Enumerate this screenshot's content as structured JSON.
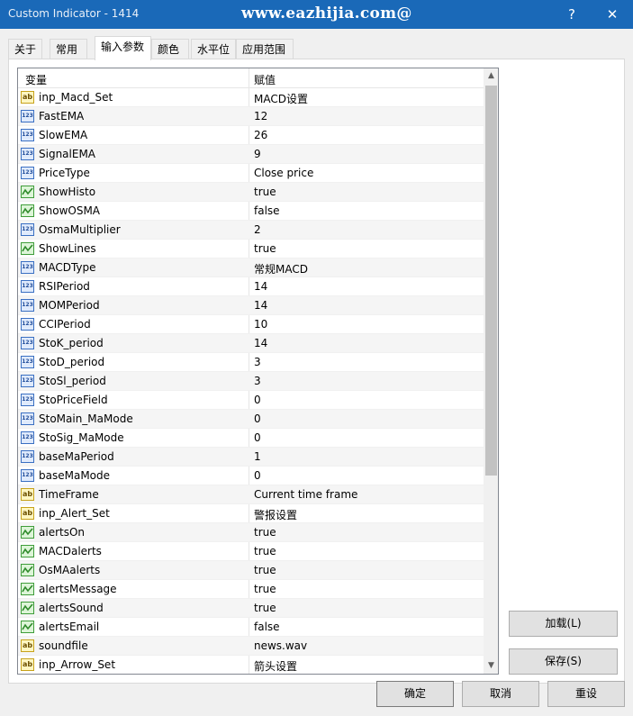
{
  "window": {
    "title": "Custom Indicator - 1414",
    "brand": "www.eazhijia.com@",
    "help_glyph": "?",
    "close_glyph": "✕"
  },
  "tabs": [
    {
      "label": "关于"
    },
    {
      "label": "常用"
    },
    {
      "label": "输入参数",
      "active": true
    },
    {
      "label": "颜色"
    },
    {
      "label": "水平位"
    },
    {
      "label": "应用范围"
    }
  ],
  "grid": {
    "col_variable": "变量",
    "col_value": "赋值",
    "rows": [
      {
        "icon": "ab",
        "name": "inp_Macd_Set",
        "value": "MACD设置"
      },
      {
        "icon": "123",
        "name": "FastEMA",
        "value": "12"
      },
      {
        "icon": "123",
        "name": "SlowEMA",
        "value": "26"
      },
      {
        "icon": "123",
        "name": "SignalEMA",
        "value": "9"
      },
      {
        "icon": "123",
        "name": "PriceType",
        "value": "Close price"
      },
      {
        "icon": "bool",
        "name": "ShowHisto",
        "value": "true"
      },
      {
        "icon": "bool",
        "name": "ShowOSMA",
        "value": "false"
      },
      {
        "icon": "123",
        "name": "OsmaMultiplier",
        "value": "2"
      },
      {
        "icon": "bool",
        "name": "ShowLines",
        "value": "true"
      },
      {
        "icon": "123",
        "name": "MACDType",
        "value": "常规MACD"
      },
      {
        "icon": "123",
        "name": "RSIPeriod",
        "value": "14"
      },
      {
        "icon": "123",
        "name": "MOMPeriod",
        "value": "14"
      },
      {
        "icon": "123",
        "name": "CCIPeriod",
        "value": "10"
      },
      {
        "icon": "123",
        "name": "StoK_period",
        "value": "14"
      },
      {
        "icon": "123",
        "name": "StoD_period",
        "value": "3"
      },
      {
        "icon": "123",
        "name": "StoSl_period",
        "value": "3"
      },
      {
        "icon": "123",
        "name": "StoPriceField",
        "value": "0"
      },
      {
        "icon": "123",
        "name": "StoMain_MaMode",
        "value": "0"
      },
      {
        "icon": "123",
        "name": "StoSig_MaMode",
        "value": "0"
      },
      {
        "icon": "123",
        "name": "baseMaPeriod",
        "value": "1"
      },
      {
        "icon": "123",
        "name": "baseMaMode",
        "value": "0"
      },
      {
        "icon": "ab",
        "name": "TimeFrame",
        "value": "Current time frame"
      },
      {
        "icon": "ab",
        "name": "inp_Alert_Set",
        "value": "警报设置"
      },
      {
        "icon": "bool",
        "name": "alertsOn",
        "value": "true"
      },
      {
        "icon": "bool",
        "name": "MACDalerts",
        "value": "true"
      },
      {
        "icon": "bool",
        "name": "OsMAalerts",
        "value": "true"
      },
      {
        "icon": "bool",
        "name": "alertsMessage",
        "value": "true"
      },
      {
        "icon": "bool",
        "name": "alertsSound",
        "value": "true"
      },
      {
        "icon": "bool",
        "name": "alertsEmail",
        "value": "false"
      },
      {
        "icon": "ab",
        "name": "soundfile",
        "value": "news.wav"
      },
      {
        "icon": "ab",
        "name": "inp_Arrow_Set",
        "value": "箭头设置"
      }
    ]
  },
  "buttons": {
    "load": "加载(L)",
    "save": "保存(S)",
    "ok": "确定",
    "cancel": "取消",
    "reset": "重设"
  },
  "icon_text": {
    "num": "123",
    "str": "ab"
  },
  "colors": {
    "titlebar": "#1a69b8",
    "numeric_icon": "#3a6fc2",
    "string_icon": "#c7a21b",
    "bool_icon": "#3f9d3a"
  }
}
